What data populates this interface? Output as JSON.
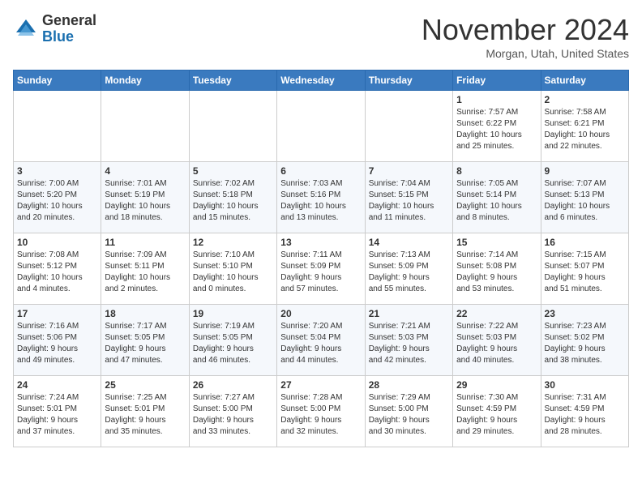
{
  "logo": {
    "general": "General",
    "blue": "Blue"
  },
  "title": "November 2024",
  "location": "Morgan, Utah, United States",
  "days_of_week": [
    "Sunday",
    "Monday",
    "Tuesday",
    "Wednesday",
    "Thursday",
    "Friday",
    "Saturday"
  ],
  "weeks": [
    [
      {
        "day": "",
        "info": ""
      },
      {
        "day": "",
        "info": ""
      },
      {
        "day": "",
        "info": ""
      },
      {
        "day": "",
        "info": ""
      },
      {
        "day": "",
        "info": ""
      },
      {
        "day": "1",
        "info": "Sunrise: 7:57 AM\nSunset: 6:22 PM\nDaylight: 10 hours\nand 25 minutes."
      },
      {
        "day": "2",
        "info": "Sunrise: 7:58 AM\nSunset: 6:21 PM\nDaylight: 10 hours\nand 22 minutes."
      }
    ],
    [
      {
        "day": "3",
        "info": "Sunrise: 7:00 AM\nSunset: 5:20 PM\nDaylight: 10 hours\nand 20 minutes."
      },
      {
        "day": "4",
        "info": "Sunrise: 7:01 AM\nSunset: 5:19 PM\nDaylight: 10 hours\nand 18 minutes."
      },
      {
        "day": "5",
        "info": "Sunrise: 7:02 AM\nSunset: 5:18 PM\nDaylight: 10 hours\nand 15 minutes."
      },
      {
        "day": "6",
        "info": "Sunrise: 7:03 AM\nSunset: 5:16 PM\nDaylight: 10 hours\nand 13 minutes."
      },
      {
        "day": "7",
        "info": "Sunrise: 7:04 AM\nSunset: 5:15 PM\nDaylight: 10 hours\nand 11 minutes."
      },
      {
        "day": "8",
        "info": "Sunrise: 7:05 AM\nSunset: 5:14 PM\nDaylight: 10 hours\nand 8 minutes."
      },
      {
        "day": "9",
        "info": "Sunrise: 7:07 AM\nSunset: 5:13 PM\nDaylight: 10 hours\nand 6 minutes."
      }
    ],
    [
      {
        "day": "10",
        "info": "Sunrise: 7:08 AM\nSunset: 5:12 PM\nDaylight: 10 hours\nand 4 minutes."
      },
      {
        "day": "11",
        "info": "Sunrise: 7:09 AM\nSunset: 5:11 PM\nDaylight: 10 hours\nand 2 minutes."
      },
      {
        "day": "12",
        "info": "Sunrise: 7:10 AM\nSunset: 5:10 PM\nDaylight: 10 hours\nand 0 minutes."
      },
      {
        "day": "13",
        "info": "Sunrise: 7:11 AM\nSunset: 5:09 PM\nDaylight: 9 hours\nand 57 minutes."
      },
      {
        "day": "14",
        "info": "Sunrise: 7:13 AM\nSunset: 5:09 PM\nDaylight: 9 hours\nand 55 minutes."
      },
      {
        "day": "15",
        "info": "Sunrise: 7:14 AM\nSunset: 5:08 PM\nDaylight: 9 hours\nand 53 minutes."
      },
      {
        "day": "16",
        "info": "Sunrise: 7:15 AM\nSunset: 5:07 PM\nDaylight: 9 hours\nand 51 minutes."
      }
    ],
    [
      {
        "day": "17",
        "info": "Sunrise: 7:16 AM\nSunset: 5:06 PM\nDaylight: 9 hours\nand 49 minutes."
      },
      {
        "day": "18",
        "info": "Sunrise: 7:17 AM\nSunset: 5:05 PM\nDaylight: 9 hours\nand 47 minutes."
      },
      {
        "day": "19",
        "info": "Sunrise: 7:19 AM\nSunset: 5:05 PM\nDaylight: 9 hours\nand 46 minutes."
      },
      {
        "day": "20",
        "info": "Sunrise: 7:20 AM\nSunset: 5:04 PM\nDaylight: 9 hours\nand 44 minutes."
      },
      {
        "day": "21",
        "info": "Sunrise: 7:21 AM\nSunset: 5:03 PM\nDaylight: 9 hours\nand 42 minutes."
      },
      {
        "day": "22",
        "info": "Sunrise: 7:22 AM\nSunset: 5:03 PM\nDaylight: 9 hours\nand 40 minutes."
      },
      {
        "day": "23",
        "info": "Sunrise: 7:23 AM\nSunset: 5:02 PM\nDaylight: 9 hours\nand 38 minutes."
      }
    ],
    [
      {
        "day": "24",
        "info": "Sunrise: 7:24 AM\nSunset: 5:01 PM\nDaylight: 9 hours\nand 37 minutes."
      },
      {
        "day": "25",
        "info": "Sunrise: 7:25 AM\nSunset: 5:01 PM\nDaylight: 9 hours\nand 35 minutes."
      },
      {
        "day": "26",
        "info": "Sunrise: 7:27 AM\nSunset: 5:00 PM\nDaylight: 9 hours\nand 33 minutes."
      },
      {
        "day": "27",
        "info": "Sunrise: 7:28 AM\nSunset: 5:00 PM\nDaylight: 9 hours\nand 32 minutes."
      },
      {
        "day": "28",
        "info": "Sunrise: 7:29 AM\nSunset: 5:00 PM\nDaylight: 9 hours\nand 30 minutes."
      },
      {
        "day": "29",
        "info": "Sunrise: 7:30 AM\nSunset: 4:59 PM\nDaylight: 9 hours\nand 29 minutes."
      },
      {
        "day": "30",
        "info": "Sunrise: 7:31 AM\nSunset: 4:59 PM\nDaylight: 9 hours\nand 28 minutes."
      }
    ]
  ]
}
